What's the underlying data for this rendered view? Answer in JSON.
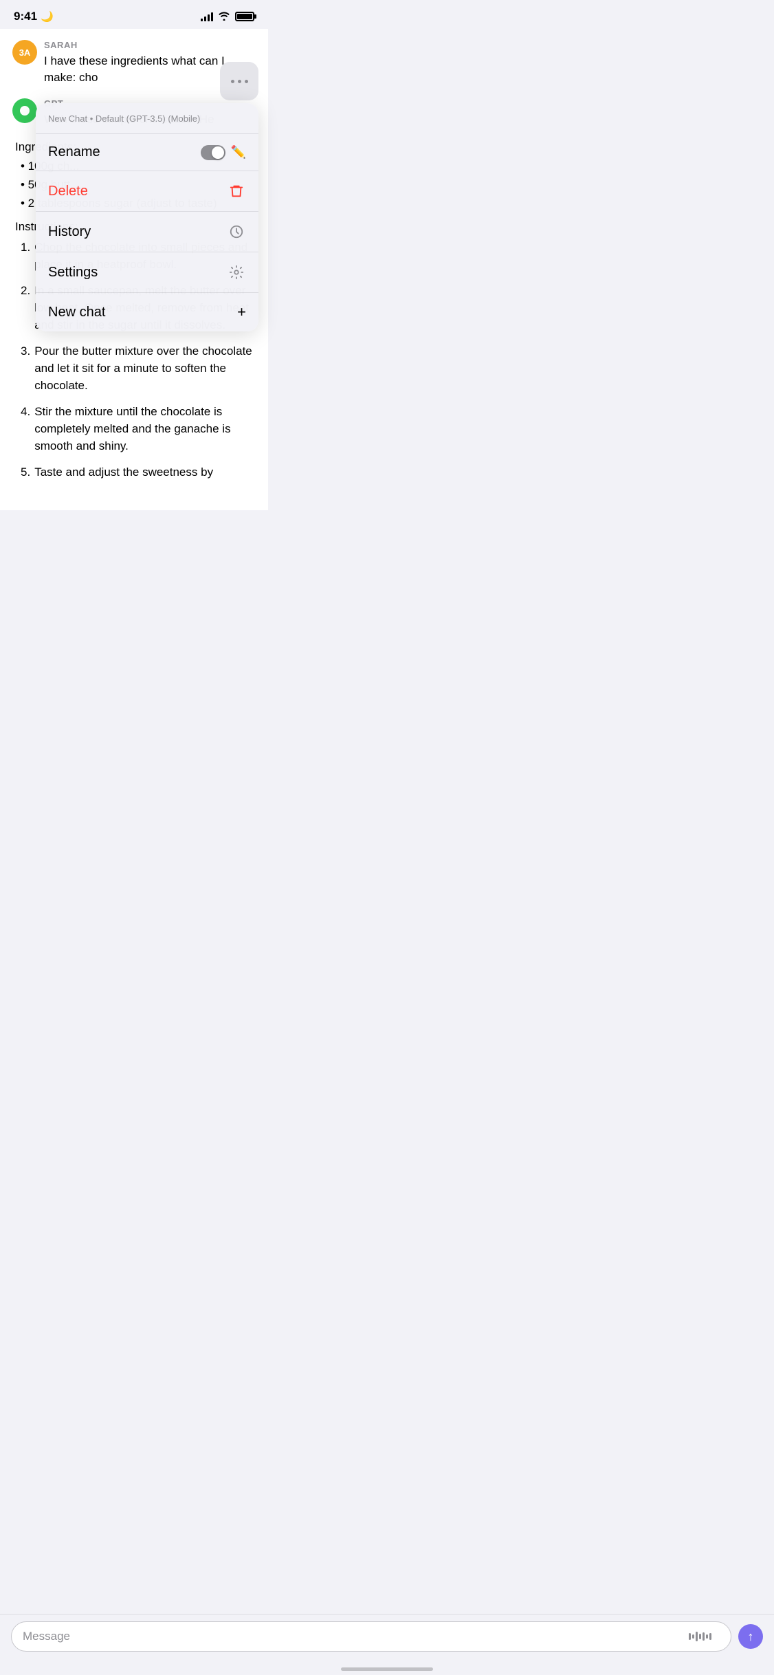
{
  "statusBar": {
    "time": "9:41",
    "moonIcon": "🌙"
  },
  "threeDotsButton": {
    "label": "···"
  },
  "dropdown": {
    "header": "New Chat • Default (GPT-3.5) (Mobile)",
    "rename": {
      "label": "Rename",
      "toggleActive": false
    },
    "delete": {
      "label": "Delete"
    },
    "history": {
      "label": "History"
    },
    "settings": {
      "label": "Settings"
    },
    "newChat": {
      "label": "New chat"
    }
  },
  "chat": {
    "sarah": {
      "avatar": "3A",
      "name": "SARAH",
      "message": "I have these ingredients what can I make: cho"
    },
    "gpt": {
      "name": "GPT",
      "message": "With those simple cho sauce. He"
    },
    "ingredients": {
      "title": "Ingredients:",
      "items": [
        "• 100g ch...",
        "• 50g butt...",
        "• 2 tablespoons sugar (adjust to taste)"
      ]
    },
    "instructions": {
      "title": "Instructions:",
      "items": [
        "Chop the chocolate into small pieces and place it in a heatproof bowl.",
        "In a small saucepan, melt the butter over low heat. Once melted, remove from heat and stir in the sugar until it dissolves.",
        "Pour the butter mixture over the chocolate and let it sit for a minute to soften the chocolate.",
        "Stir the mixture until the chocolate is completely melted and the ganache is smooth and shiny.",
        "Taste and adjust the sweetness by"
      ]
    }
  },
  "inputBar": {
    "placeholder": "Message",
    "sendLabel": "↑"
  }
}
